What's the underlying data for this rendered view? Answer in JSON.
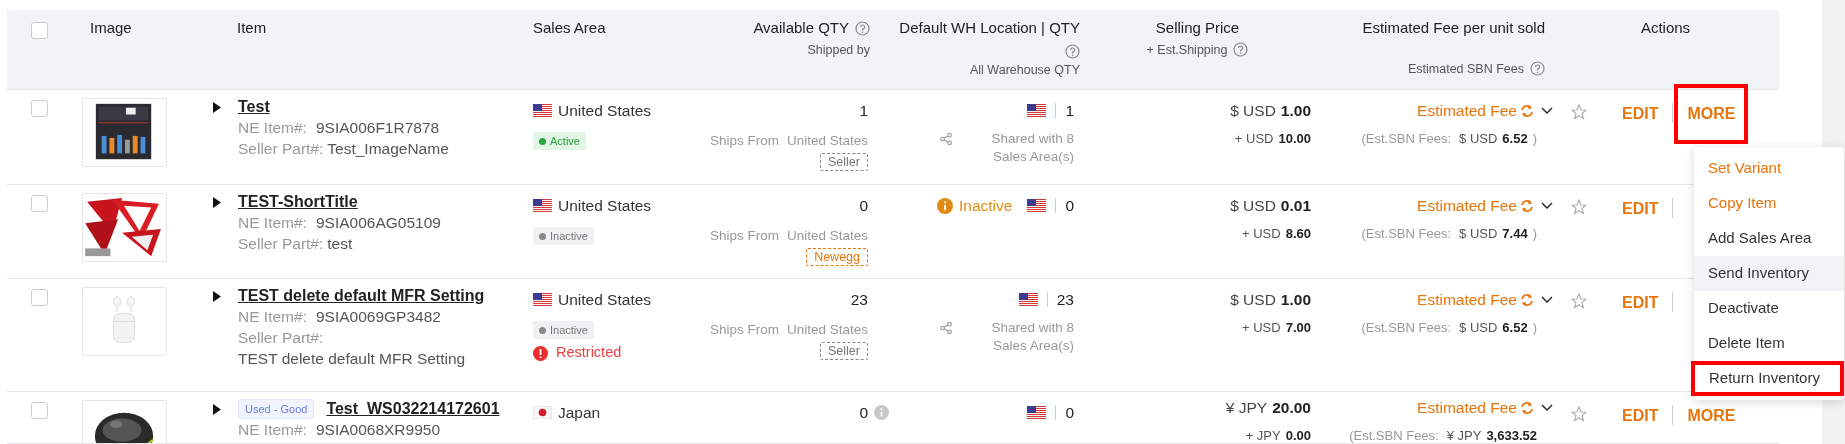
{
  "select_all": {
    "checked": false
  },
  "columns": [
    {
      "label": "Image"
    },
    {
      "label": "Item"
    },
    {
      "label": "Sales Area"
    },
    {
      "label": "Available QTY",
      "sublabel": "Shipped by"
    },
    {
      "label": "Default WH Location | QTY",
      "sublabel": "All Warehouse QTY"
    },
    {
      "label": "Selling Price",
      "sublabel": "+ Est.Shipping"
    },
    {
      "label": "Estimated Fee per unit sold",
      "sublabel": "Estimated SBN Fees"
    },
    {
      "label": "Actions"
    }
  ],
  "rows": [
    {
      "checked": false,
      "title": "Test",
      "ne_label": "NE Item#:",
      "ne_item": "9SIA006F1R7878",
      "part_label": "Seller Part#:",
      "part": "Test_ImageName",
      "area": {
        "kind": "us",
        "country": "United States"
      },
      "status": {
        "label": "Active",
        "active": true
      },
      "qty": "1",
      "ships_label": "Ships From",
      "ships_from": "United States",
      "shipped_by": {
        "label": "Seller",
        "kind": "seller"
      },
      "wh": {
        "kind": "us",
        "qty": "1",
        "shared": "Shared with 8 Sales Area(s)"
      },
      "price": {
        "currency": "$ USD",
        "amount": "1.00",
        "ship_currency": "+ USD",
        "ship_amount": "10.00"
      },
      "fee": {
        "label": "Estimated Fee",
        "sbn_label": "(Est.SBN Fees:",
        "sbn_currency": "$ USD",
        "sbn_amount": "6.52",
        "sbn_close": ")"
      },
      "starred": false,
      "edit": "EDIT",
      "more": "MORE",
      "more_highlighted": true
    },
    {
      "checked": false,
      "title": "TEST-ShortTitle",
      "ne_label": "NE Item#:",
      "ne_item": "9SIA006AG05109",
      "part_label": "Seller Part#:",
      "part": "test",
      "area": {
        "kind": "us",
        "country": "United States"
      },
      "status": {
        "label": "Inactive",
        "active": false
      },
      "qty": "0",
      "ships_label": "Ships From",
      "ships_from": "United States",
      "shipped_by": {
        "label": "Newegg",
        "kind": "newegg"
      },
      "wh": {
        "inactive": "Inactive",
        "kind": "us",
        "qty": "0"
      },
      "price": {
        "currency": "$ USD",
        "amount": "0.01",
        "ship_currency": "+ USD",
        "ship_amount": "8.60"
      },
      "fee": {
        "label": "Estimated Fee",
        "sbn_label": "(Est.SBN Fees:",
        "sbn_currency": "$ USD",
        "sbn_amount": "7.44",
        "sbn_close": ")"
      },
      "starred": false,
      "edit": "EDIT"
    },
    {
      "checked": false,
      "title": "TEST delete default MFR Setting",
      "ne_label": "NE Item#:",
      "ne_item": "9SIA0069GP3482",
      "part_label": "Seller Part#:",
      "part": "TEST delete default MFR Setting",
      "area": {
        "kind": "us",
        "country": "United States"
      },
      "status": {
        "label": "Inactive",
        "active": false
      },
      "restricted": "Restricted",
      "qty": "23",
      "ships_label": "Ships From",
      "ships_from": "United States",
      "shipped_by": {
        "label": "Seller",
        "kind": "seller"
      },
      "wh": {
        "kind": "us",
        "qty": "23",
        "shared": "Shared with 8 Sales Area(s)"
      },
      "price": {
        "currency": "$ USD",
        "amount": "1.00",
        "ship_currency": "+ USD",
        "ship_amount": "7.00"
      },
      "fee": {
        "label": "Estimated Fee",
        "sbn_label": "(Est.SBN Fees:",
        "sbn_currency": "$ USD",
        "sbn_amount": "6.52",
        "sbn_close": ")"
      },
      "starred": false,
      "edit": "EDIT"
    },
    {
      "checked": false,
      "condition": "Used - Good",
      "title": "Test_WS032214172601",
      "ne_label": "NE Item#:",
      "ne_item": "9SIA0068XR9950",
      "area": {
        "kind": "jp",
        "country": "Japan"
      },
      "qty": "0",
      "qty_info": true,
      "wh": {
        "kind": "us",
        "qty": "0"
      },
      "price": {
        "currency": "¥ JPY",
        "amount": "20.00",
        "ship_currency": "+ JPY",
        "ship_amount": "0.00"
      },
      "fee": {
        "label": "Estimated Fee",
        "sbn_label": "(Est.SBN Fees:",
        "sbn_currency": "¥ JPY",
        "sbn_amount": "3,633.52"
      },
      "starred": false,
      "edit": "EDIT",
      "more": "MORE",
      "more_highlighted": false
    }
  ],
  "menu": [
    {
      "label": "Set Variant",
      "accent": true,
      "hovered": false,
      "highlighted": false
    },
    {
      "label": "Copy Item",
      "accent": true,
      "hovered": false,
      "highlighted": false
    },
    {
      "label": "Add Sales Area",
      "accent": false,
      "hovered": false,
      "highlighted": false
    },
    {
      "label": "Send Inventory",
      "accent": false,
      "hovered": true,
      "highlighted": false
    },
    {
      "label": "Deactivate",
      "accent": false,
      "hovered": false,
      "highlighted": false
    },
    {
      "label": "Delete Item",
      "accent": false,
      "hovered": false,
      "highlighted": false
    },
    {
      "label": "Return Inventory",
      "accent": false,
      "hovered": false,
      "highlighted": true
    }
  ]
}
